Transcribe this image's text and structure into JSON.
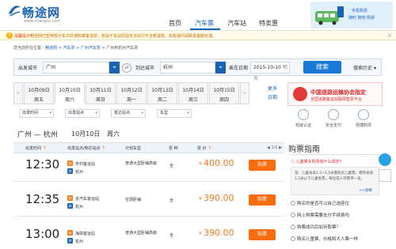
{
  "header": {
    "logo_text": "畅途网",
    "logo_domain": "www.changtu.com",
    "nav": [
      "首页",
      "汽车票",
      "汽车站",
      "特卖惠"
    ],
    "banner_line1": "手机购票",
    "banner_line2": "随时 随地 购票"
  },
  "notice": {
    "label": "温馨提示：",
    "text": "畅途网已暂停部分车次并通知乘客退票，若由于车站原因无法出行可全额退款。如有疑问请联系客服处理。",
    "close": "×"
  },
  "breadcrumb": {
    "prefix": "您当前所在位置：",
    "items": [
      "畅途网",
      "汽车票",
      "广州汽车票",
      "广州到杭州汽车票"
    ],
    "sep": ">"
  },
  "search": {
    "from_label": "出发城市",
    "from_value": "广州",
    "to_label": "到达城市",
    "to_value": "杭州",
    "date_label": "乘车日期",
    "date_value": "2015-10-10",
    "date_weekday": "明天",
    "button": "搜索",
    "history": "搜索历史"
  },
  "dates": [
    {
      "date": "10月09日",
      "day": "周五"
    },
    {
      "date": "10月10日",
      "day": "周六"
    },
    {
      "date": "10月11日",
      "day": "周日"
    },
    {
      "date": "10月12日",
      "day": "周一"
    },
    {
      "date": "10月13日",
      "day": "周二"
    },
    {
      "date": "10月14日",
      "day": "周三"
    },
    {
      "date": "10月15日",
      "day": "周四"
    }
  ],
  "more_dates": [
    "更多",
    "日期"
  ],
  "filters": [
    "出发时间",
    "出发站点",
    "抵达站点",
    "车型"
  ],
  "route": {
    "title": "广州 — 杭州",
    "date": "10月10日",
    "weekday": "周六"
  },
  "table": {
    "headers": [
      "出发时间",
      "出发站点/到达站点",
      "计划车型",
      "票 种",
      "票 价"
    ],
    "pager": "◀ 1/1 ▶",
    "rows": [
      {
        "time": "12:30",
        "from": "芳村客运站",
        "to": "杭州",
        "bus": "普通大型卧铺高级",
        "ticket": "全",
        "price": "400.00",
        "buy": "购票"
      },
      {
        "time": "12:35",
        "from": "省汽车客运站",
        "to": "杭州",
        "bus": "空调卧铺",
        "ticket": "全",
        "price": "390.00",
        "buy": "购票"
      },
      {
        "time": "13:00",
        "from": "海珠客运站",
        "to": "杭州",
        "bus": "普通大型卧铺高级",
        "ticket": "全",
        "price": "390.00",
        "buy": "购票"
      }
    ],
    "from_badge": "始",
    "to_badge": "终"
  },
  "promo": {
    "title": "中国道路运输协会指定",
    "sub": "全国道路客运站联网售票平台"
  },
  "features": [
    "权威认证",
    "安全支付",
    "便捷购票"
  ],
  "guide": {
    "title": "购票指南",
    "q1": "儿童乘车购票有什么规定？",
    "q1_answer": "答：儿童身高1.2~1.5米需购买儿童票，携带身高1.2米以下儿童免票，每位成人可携带一名。",
    "q1_more": ">>详细",
    "questions": [
      "购买的是否可以自己选座位",
      "网上购票需要支付手续费吗",
      "购票成功后如何取票？",
      "购买儿童票，价格和大人票一样"
    ]
  }
}
